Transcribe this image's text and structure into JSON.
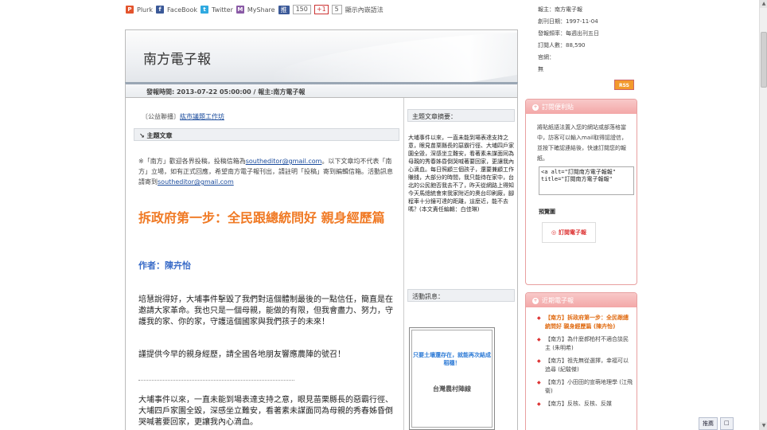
{
  "social": {
    "plurk": "Plurk",
    "facebook": "FaceBook",
    "twitter": "Twitter",
    "myshare": "MyShare",
    "push_label": "推",
    "push_count": "150",
    "gplus_label": "+1",
    "gplus_count": "5",
    "embed_link": "顯示內嵌語法"
  },
  "header": {
    "site_title": "南方電子報",
    "dateline": "發報時間: 2013-07-22 05:00:00 / 報主:南方電子報"
  },
  "main": {
    "ad_prefix": "〔公益聯播〕",
    "ad_link": "紘市議題工作坊",
    "topic_label": "主題文章",
    "intro_part1": "※「南方」歡迎各界投稿，投稿信箱為",
    "intro_email1": "southeditor@gmail.com",
    "intro_part2": "。以下文章均不代表「南方」立場，如有正式回應，希望南方電子報刊出，請註明「投稿」寄到編輯信箱。活動訊息請寄到",
    "intro_email2": "southeditor@gmail.com",
    "article_title": "拆政府第一步：全民跟總統問好 親身經歷篇",
    "author": "作者：陳卉怡",
    "para1": "培慧說得好，大埔事件擊毀了我們對這個體制最後的一點信任，簡直是在邀請大家革命。我也只是一個母親，能做的有限，但我會盡力、努力，守護我的家、你的家，守護這個國家與我們孩子的未來！",
    "para2": "謹提供今早的親身經歷，請全國各地朋友響應農陣的號召！",
    "para3": "大埔事件以來，一直未能到場表達支持之意，眼見苗栗縣長的惡霸行徑、大埔四戶家園全毀，深感坐立難安，看著素未謀面同為母親的秀春姊昏倒哭喊著要回家，更讓我內心滴血。"
  },
  "mid": {
    "summary_label": "主題文章摘要：",
    "summary_text": "大埔事件以來，一直未能到場表達支持之意，眼見苗栗縣長的惡霸行徑、大埔四戶家園全毀，深感坐立難安，看著素未謀面同為母親的秀春姊昏倒哭喊著要回家，更讓我內心滴血。每日照顧三個孩子，還要兼顧工作賺錢，大部分的時間，我只能待在家中，台北的公民飽否我去不了，昨天從網路上得知今天馬總統會來我家附近的奧台印刷廠，腳程車十分鐘可達的距離，這麼近，能不去嗎？(本文責任編輯：白佳琳)",
    "events_label": "活動訊息：",
    "promo_slogan": "只要土壤還存在，就能再次結成稻穗！",
    "promo_org": "台灣農村陣線"
  },
  "side": {
    "meta": [
      "報主：南方電子報",
      "創刊日期：1997-11-04",
      "發報頻率：每週出刊五日",
      "訂閱人數：88,590",
      "官網：",
      "無"
    ],
    "rss": "RSS",
    "subscribe_title": "訂閱便利貼",
    "subscribe_text": "將貼紙語法置入您的網站或部落格當中，訪客可以輸入mail取得認證信，並按下確認連結後，快速訂閱您的報紙。",
    "subscribe_code": "<a alt=\"訂閱南方電子報報\" title=\"訂閱南方電子報報\"",
    "preview_label": "預覽圖",
    "sub_logo_text": "訂閱電子報",
    "recent_title": "近期電子報",
    "recent": [
      "【南方】拆政府第一步：全民跟總統問好 親身經歷篇 (陳卉怡)",
      "【南方】為什麼郝柏村不適合談民主 (朱明希)",
      "【南方】祖先無從選擇，幸福可以追尋 (紀駿傑)",
      "【南方】小田田的宣萌地理學 (江飛衛)",
      "【南方】反核、反核、反媒"
    ]
  },
  "bottom": {
    "push": "推薦",
    "square": "□"
  }
}
